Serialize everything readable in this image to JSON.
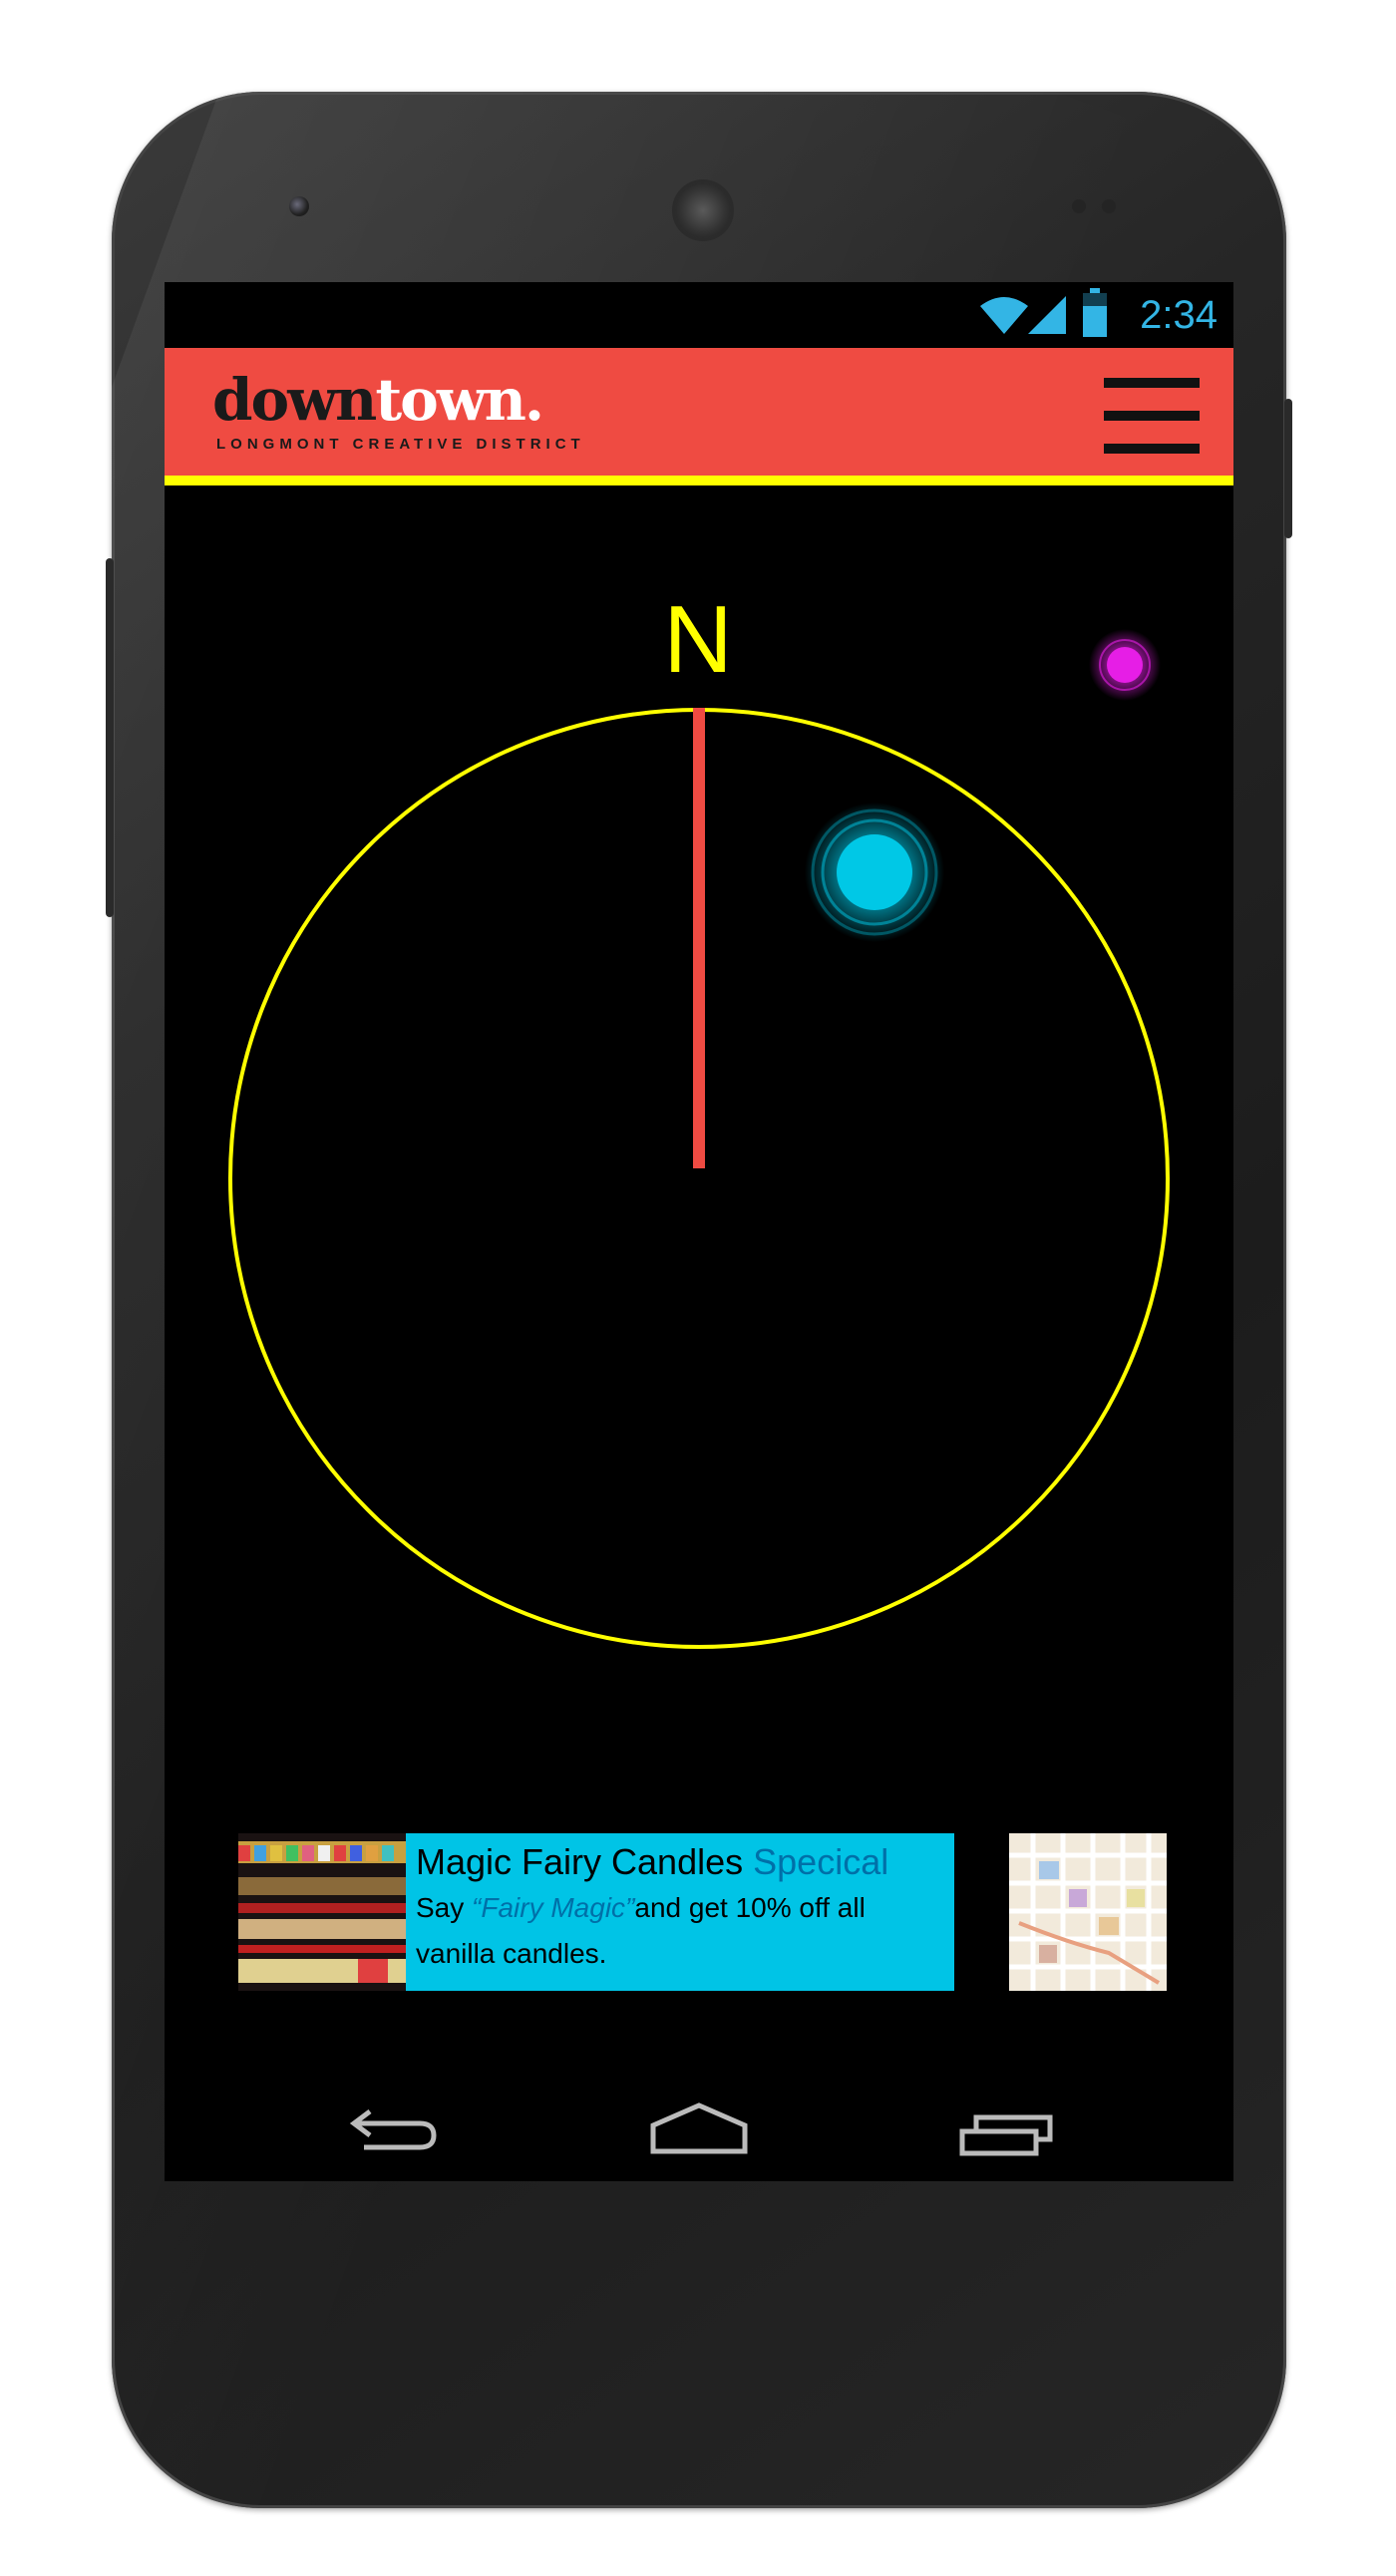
{
  "status_bar": {
    "time": "2:34",
    "icons": [
      "wifi-icon",
      "signal-icon",
      "battery-icon"
    ],
    "icon_color": "#33b5e5"
  },
  "app_bar": {
    "logo_part1": "down",
    "logo_part2": "town.",
    "logo_tagline": "LONGMONT CREATIVE DISTRICT",
    "menu_icon": "hamburger-menu-icon",
    "background_color": "#ef4b42",
    "underline_color": "#ffff00"
  },
  "compass": {
    "north_label": "N",
    "ring_color": "#ffff00",
    "needle_color": "#ef4b42",
    "markers": [
      {
        "name": "cyan-location-marker",
        "color": "#00c8e6"
      },
      {
        "name": "magenta-location-marker",
        "color": "#e61ee6"
      }
    ]
  },
  "promo": {
    "title": "Magic Fairy Candles",
    "title_accent": "Specical",
    "body_prefix": "Say ",
    "body_highlight": "“Fairy Magic”",
    "body_suffix": "and get 10% off all vanilla candles.",
    "card_color": "#00c4e6"
  },
  "nav_bar": {
    "buttons": [
      "back-icon",
      "home-icon",
      "recent-apps-icon"
    ]
  }
}
